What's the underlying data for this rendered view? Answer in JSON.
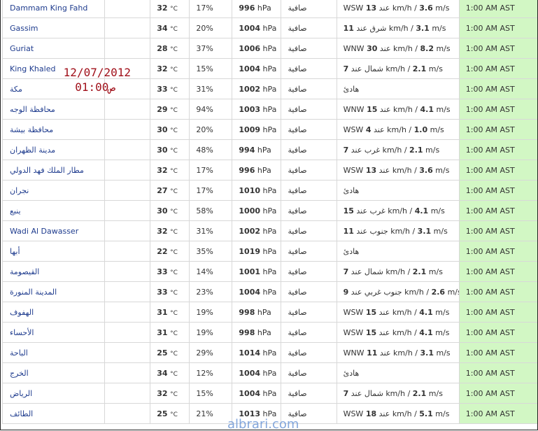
{
  "units": {
    "temp": "°C",
    "pressure": "hPa",
    "speed_kmh": "km/h",
    "speed_ms": "m/s"
  },
  "accent_colors": {
    "time_cell_bg": "#d2f7c4",
    "city_link": "#1f3c8e",
    "stamp": "#a0101a",
    "watermark": "#6f98d6"
  },
  "stamp": {
    "date": "12/07/2012",
    "time": "01:00ص"
  },
  "watermark": "albrari.com",
  "rows": [
    {
      "city": "Dammam King Fahd",
      "temp": "32",
      "humidity": "17%",
      "pressure": "996",
      "condition": "صافية",
      "wind_dir": "WSW",
      "wind_kmh": "13",
      "wind_ar": "عند",
      "wind_ms": "3.6",
      "time": "1:00 AM AST"
    },
    {
      "city": "Gassim",
      "temp": "34",
      "humidity": "20%",
      "pressure": "1004",
      "condition": "صافية",
      "wind_dir": "",
      "wind_kmh": "11",
      "wind_ar": "شرق عند",
      "wind_ms": "3.1",
      "time": "1:00 AM AST"
    },
    {
      "city": "Guriat",
      "temp": "28",
      "humidity": "37%",
      "pressure": "1006",
      "condition": "صافية",
      "wind_dir": "WNW",
      "wind_kmh": "30",
      "wind_ar": "عند",
      "wind_ms": "8.2",
      "time": "1:00 AM AST"
    },
    {
      "city": "King Khaled",
      "temp": "32",
      "humidity": "15%",
      "pressure": "1004",
      "condition": "صافية",
      "wind_dir": "",
      "wind_kmh": "7",
      "wind_ar": "شمال عند",
      "wind_ms": "2.1",
      "time": "1:00 AM AST"
    },
    {
      "city": "مكة",
      "temp": "33",
      "humidity": "31%",
      "pressure": "1002",
      "condition": "صافية",
      "wind_calm": "هادئ",
      "time": "1:00 AM AST"
    },
    {
      "city": "محافظة الوجه",
      "temp": "29",
      "humidity": "94%",
      "pressure": "1003",
      "condition": "صافية",
      "wind_dir": "WNW",
      "wind_kmh": "15",
      "wind_ar": "عند",
      "wind_ms": "4.1",
      "time": "1:00 AM AST"
    },
    {
      "city": "محافظة بيشة",
      "temp": "30",
      "humidity": "20%",
      "pressure": "1009",
      "condition": "صافية",
      "wind_dir": "WSW",
      "wind_kmh": "4",
      "wind_ar": "عند",
      "wind_ms": "1.0",
      "time": "1:00 AM AST"
    },
    {
      "city": "مدينة الظهران",
      "temp": "30",
      "humidity": "48%",
      "pressure": "994",
      "condition": "صافية",
      "wind_dir": "",
      "wind_kmh": "7",
      "wind_ar": "غرب عند",
      "wind_ms": "2.1",
      "time": "1:00 AM AST"
    },
    {
      "city": "مطار الملك فهد الدولي",
      "temp": "32",
      "humidity": "17%",
      "pressure": "996",
      "condition": "صافية",
      "wind_dir": "WSW",
      "wind_kmh": "13",
      "wind_ar": "عند",
      "wind_ms": "3.6",
      "time": "1:00 AM AST"
    },
    {
      "city": "نجران",
      "temp": "27",
      "humidity": "17%",
      "pressure": "1010",
      "condition": "صافية",
      "wind_calm": "هادئ",
      "time": "1:00 AM AST"
    },
    {
      "city": "ينبع",
      "temp": "30",
      "humidity": "58%",
      "pressure": "1000",
      "condition": "صافية",
      "wind_dir": "",
      "wind_kmh": "15",
      "wind_ar": "غرب عند",
      "wind_ms": "4.1",
      "time": "1:00 AM AST"
    },
    {
      "city": "Wadi Al Dawasser",
      "temp": "32",
      "humidity": "31%",
      "pressure": "1002",
      "condition": "صافية",
      "wind_dir": "",
      "wind_kmh": "11",
      "wind_ar": "جنوب عند",
      "wind_ms": "3.1",
      "time": "1:00 AM AST"
    },
    {
      "city": "أبها",
      "temp": "22",
      "humidity": "35%",
      "pressure": "1019",
      "condition": "صافية",
      "wind_calm": "هادئ",
      "time": "1:00 AM AST"
    },
    {
      "city": "القيصومة",
      "temp": "33",
      "humidity": "14%",
      "pressure": "1001",
      "condition": "صافية",
      "wind_dir": "",
      "wind_kmh": "7",
      "wind_ar": "شمال عند",
      "wind_ms": "2.1",
      "time": "1:00 AM AST"
    },
    {
      "city": "المدينة المنورة",
      "temp": "33",
      "humidity": "23%",
      "pressure": "1004",
      "condition": "صافية",
      "wind_dir": "",
      "wind_kmh": "9",
      "wind_ar": "جنوب غربي عند",
      "wind_ms": "2.6",
      "time": "1:00 AM AST"
    },
    {
      "city": "الهفوف",
      "temp": "31",
      "humidity": "19%",
      "pressure": "998",
      "condition": "صافية",
      "wind_dir": "WSW",
      "wind_kmh": "15",
      "wind_ar": "عند",
      "wind_ms": "4.1",
      "time": "1:00 AM AST"
    },
    {
      "city": "الأحساء",
      "temp": "31",
      "humidity": "19%",
      "pressure": "998",
      "condition": "صافية",
      "wind_dir": "WSW",
      "wind_kmh": "15",
      "wind_ar": "عند",
      "wind_ms": "4.1",
      "time": "1:00 AM AST"
    },
    {
      "city": "الباحة",
      "temp": "25",
      "humidity": "29%",
      "pressure": "1014",
      "condition": "صافية",
      "wind_dir": "WNW",
      "wind_kmh": "11",
      "wind_ar": "عند",
      "wind_ms": "3.1",
      "time": "1:00 AM AST"
    },
    {
      "city": "الخرج",
      "temp": "34",
      "humidity": "12%",
      "pressure": "1004",
      "condition": "صافية",
      "wind_calm": "هادئ",
      "time": "1:00 AM AST"
    },
    {
      "city": "الرياض",
      "temp": "32",
      "humidity": "15%",
      "pressure": "1004",
      "condition": "صافية",
      "wind_dir": "",
      "wind_kmh": "7",
      "wind_ar": "شمال عند",
      "wind_ms": "2.1",
      "time": "1:00 AM AST"
    },
    {
      "city": "الطائف",
      "temp": "25",
      "humidity": "21%",
      "pressure": "1013",
      "condition": "صافية",
      "wind_dir": "WSW",
      "wind_kmh": "18",
      "wind_ar": "عند",
      "wind_ms": "5.1",
      "time": "1:00 AM AST"
    }
  ]
}
